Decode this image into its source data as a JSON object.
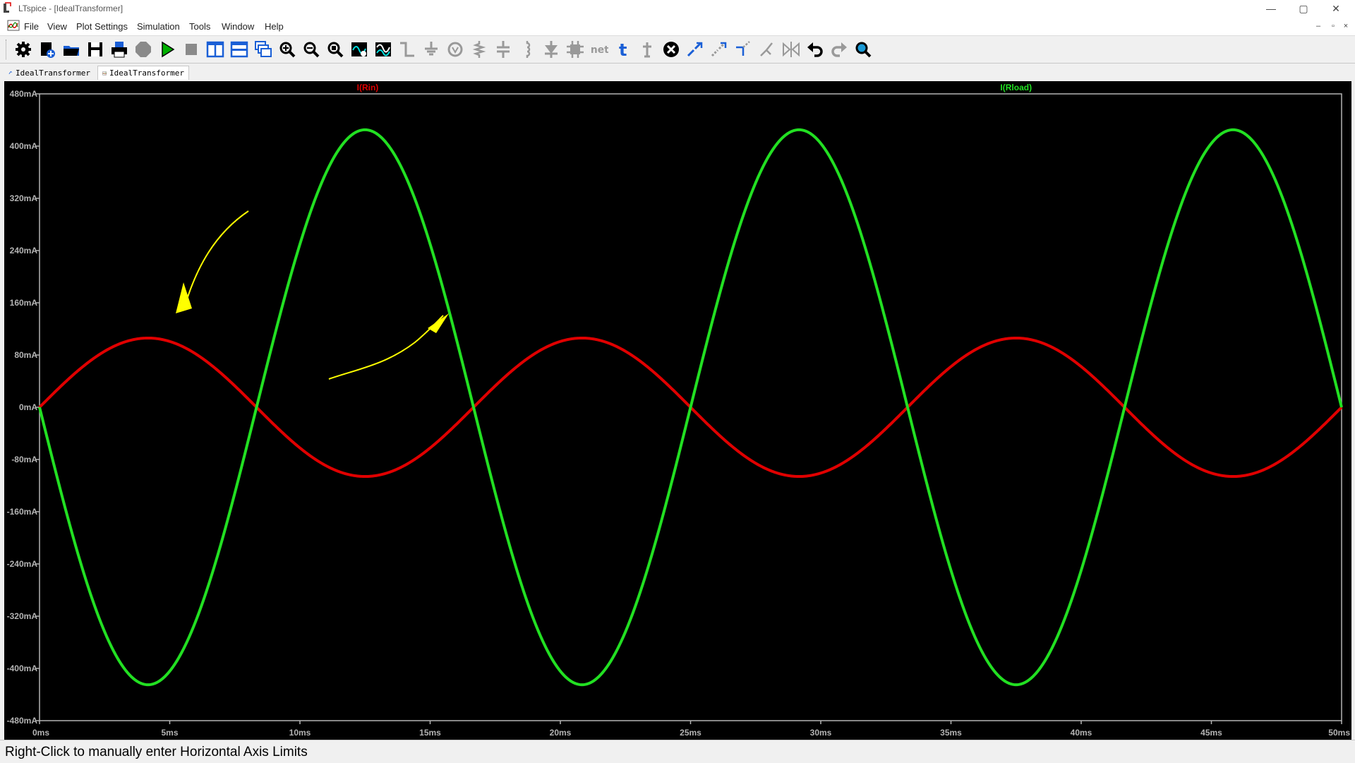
{
  "window": {
    "title": "LTspice - [IdealTransformer]",
    "controls": {
      "minimize": "—",
      "restore": "▢",
      "close": "✕"
    }
  },
  "menu": {
    "items": [
      "File",
      "View",
      "Plot Settings",
      "Simulation",
      "Tools",
      "Window",
      "Help"
    ],
    "mdi": {
      "minimize": "–",
      "restore": "▫",
      "close": "×"
    }
  },
  "toolbar": {
    "buttons": [
      "settings-icon",
      "new-schematic-icon",
      "open-icon",
      "save-icon",
      "print-icon",
      "halt-icon",
      "run-icon",
      "stop-icon",
      "tile-vertical-icon",
      "tile-horizontal-icon",
      "cascade-icon",
      "zoom-in-icon",
      "zoom-out-icon",
      "zoom-fit-icon",
      "autorange-icon",
      "waveform-icon",
      "wire-icon",
      "ground-icon",
      "voltage-source-icon",
      "resistor-icon",
      "capacitor-icon",
      "inductor-icon",
      "diode-icon",
      "component-icon",
      "net-label-icon",
      "text-icon",
      "spice-directive-icon",
      "delete-icon",
      "duplicate-icon",
      "move-icon",
      "drag-icon",
      "rotate-icon",
      "mirror-icon",
      "undo-icon",
      "redo-icon",
      "find-icon"
    ],
    "net_label_text": "net",
    "text_tool_glyph": "t"
  },
  "tabs": [
    {
      "label": "IdealTransformer",
      "type": "schematic",
      "active": false
    },
    {
      "label": "IdealTransformer",
      "type": "waveform",
      "active": true
    }
  ],
  "colors": {
    "plot_bg": "#000000",
    "axis_text": "#b4b4b4",
    "trace_rin": "#e00000",
    "trace_rload": "#22e022",
    "annotation": "#ffff00"
  },
  "chart_data": {
    "type": "line",
    "title": "",
    "xlabel": "",
    "ylabel": "",
    "xlim": [
      0,
      50
    ],
    "x_unit": "ms",
    "ylim": [
      -480,
      480
    ],
    "y_unit": "mA",
    "x_ticks": [
      "0ms",
      "5ms",
      "10ms",
      "15ms",
      "20ms",
      "25ms",
      "30ms",
      "35ms",
      "40ms",
      "45ms",
      "50ms"
    ],
    "y_ticks": [
      "480mA",
      "400mA",
      "320mA",
      "240mA",
      "160mA",
      "80mA",
      "0mA",
      "-80mA",
      "-160mA",
      "-240mA",
      "-320mA",
      "-400mA",
      "-480mA"
    ],
    "grid": false,
    "series": [
      {
        "name": "I(Rin)",
        "color": "#e00000",
        "waveform": "sine",
        "amplitude_mA": 106,
        "frequency_Hz": 60,
        "phase": "starts at 0 rising",
        "x": [
          0,
          4.17,
          8.33,
          12.5,
          16.67,
          20.83,
          25,
          29.17,
          33.33,
          37.5,
          41.67,
          45.83,
          50
        ],
        "y": [
          0,
          106,
          0,
          -106,
          0,
          106,
          0,
          -106,
          0,
          106,
          0,
          -106,
          0
        ]
      },
      {
        "name": "I(Rload)",
        "color": "#22e022",
        "waveform": "sine",
        "amplitude_mA": 425,
        "frequency_Hz": 60,
        "phase": "starts at 0 falling",
        "x": [
          0,
          4.17,
          8.33,
          12.5,
          16.67,
          20.83,
          25,
          29.17,
          33.33,
          37.5,
          41.67,
          45.83,
          50
        ],
        "y": [
          0,
          -425,
          0,
          425,
          0,
          -425,
          0,
          425,
          0,
          -425,
          0,
          425,
          0
        ]
      }
    ]
  },
  "status": {
    "message": "Right-Click to manually enter Horizontal Axis Limits"
  }
}
